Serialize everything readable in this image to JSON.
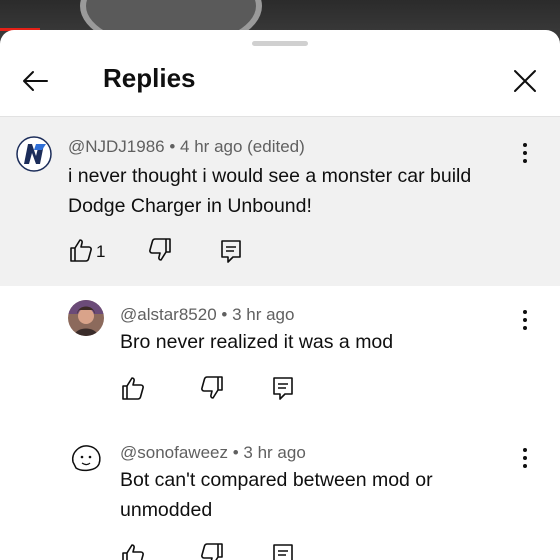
{
  "panel": {
    "title": "Replies"
  },
  "parent_comment": {
    "handle": "@NJDJ1986",
    "meta": "4 hr ago (edited)",
    "text_line1": "i never thought i would see a monster car build",
    "text_line2": "Dodge Charger in Unbound!",
    "like_count": "1"
  },
  "replies": [
    {
      "handle": "@alstar8520",
      "meta": "3 hr ago",
      "text_line1": "Bro never realized it was a mod",
      "text_line2": ""
    },
    {
      "handle": "@sonofaweez",
      "meta": "3 hr ago",
      "text_line1": "Bot can't compared between mod or",
      "text_line2": "unmodded"
    }
  ],
  "separator": " • ",
  "colors": {
    "accent_red": "#e62117",
    "highlight_bg": "#f1f1f1",
    "meta_gray": "#606060",
    "logo_navy": "#1c2d5a"
  },
  "icons": [
    "back-arrow-icon",
    "close-icon",
    "more-vert-icon",
    "thumb-up-icon",
    "thumb-down-icon",
    "reply-icon"
  ]
}
